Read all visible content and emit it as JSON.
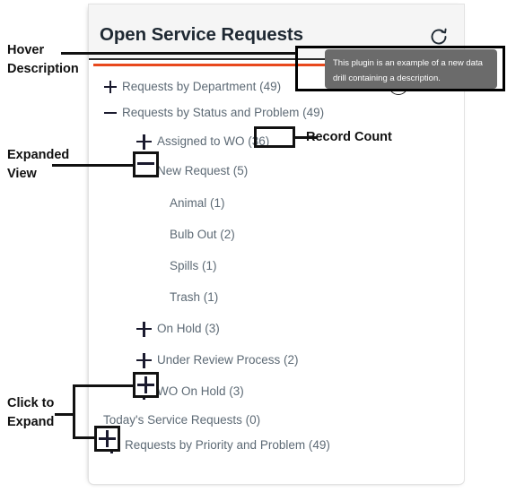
{
  "panel": {
    "title": "Open Service Requests",
    "refresh_icon": "refresh-icon",
    "help_icon": "help-circle-icon",
    "accent_color": "#e8491d",
    "header_bg": "#f5f5f5",
    "label_color": "#5d6a75"
  },
  "tooltip": {
    "text": "This plugin is an example of a new data drill containing a description.",
    "bg_color": "#6b6b6b"
  },
  "tree": [
    {
      "label": "Requests by Department (49)",
      "state": "collapsed",
      "indent": 0,
      "boxed": false
    },
    {
      "label": "Requests by Status and Problem (49)",
      "state": "expanded",
      "indent": 0,
      "boxed": false
    },
    {
      "label": "Assigned to WO (36)",
      "state": "collapsed",
      "indent": 1,
      "boxed": false
    },
    {
      "label": "New Request (5)",
      "state": "expanded",
      "indent": 1,
      "boxed": true
    },
    {
      "label": "Animal (1)",
      "state": "leaf",
      "indent": 2,
      "boxed": false
    },
    {
      "label": "Bulb Out (2)",
      "state": "leaf",
      "indent": 2,
      "boxed": false
    },
    {
      "label": "Spills (1)",
      "state": "leaf",
      "indent": 2,
      "boxed": false
    },
    {
      "label": "Trash (1)",
      "state": "leaf",
      "indent": 2,
      "boxed": false
    },
    {
      "label": "On Hold (3)",
      "state": "collapsed",
      "indent": 1,
      "boxed": false
    },
    {
      "label": "Under Review Process (2)",
      "state": "collapsed",
      "indent": 1,
      "boxed": false
    },
    {
      "label": "WO On Hold (3)",
      "state": "collapsed",
      "indent": 1,
      "boxed": true
    },
    {
      "label": "Today's Service Requests (0)",
      "state": "leaf",
      "indent": 0,
      "boxed": false
    },
    {
      "label": "Requests by Priority and Problem (49)",
      "state": "collapsed",
      "indent": 0,
      "boxed": true
    }
  ],
  "annotations": [
    {
      "id": "hover-description",
      "text": "Hover\nDescription"
    },
    {
      "id": "expanded-view",
      "text": "Expanded\nView"
    },
    {
      "id": "click-to-expand",
      "text": "Click to\nExpand"
    },
    {
      "id": "record-count",
      "text": "Record Count"
    }
  ]
}
